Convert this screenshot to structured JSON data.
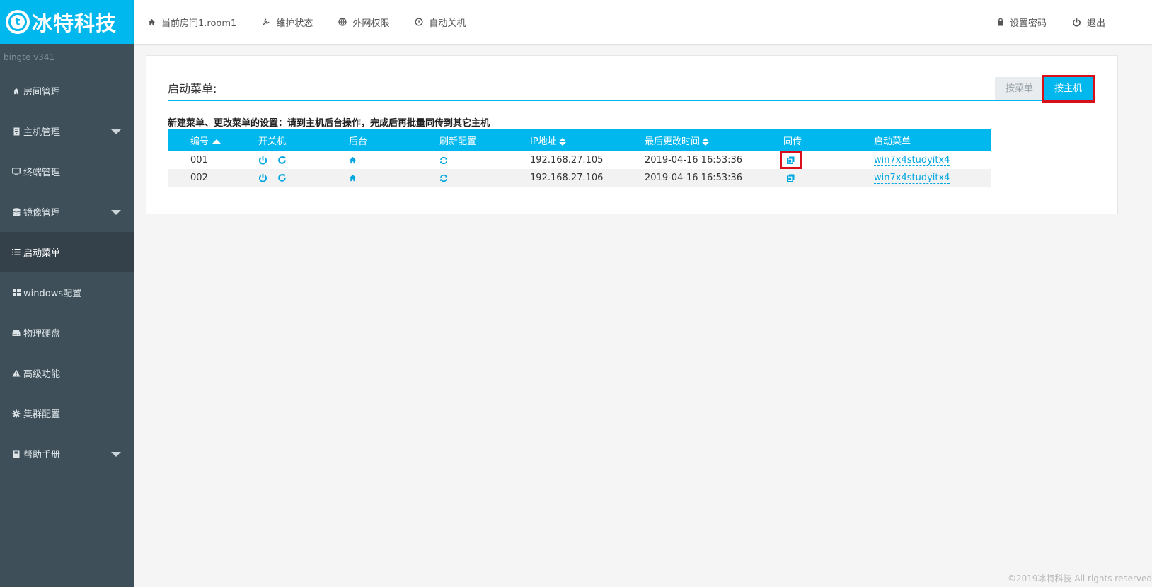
{
  "brand": {
    "logo_letter": "t",
    "name": "冰特科技"
  },
  "version": "bingte  v341",
  "topnav": {
    "left": [
      {
        "icon": "home-icon",
        "label": "当前房间1.room1"
      },
      {
        "icon": "wrench-icon",
        "label": "维护状态"
      },
      {
        "icon": "globe-icon",
        "label": "外网权限"
      },
      {
        "icon": "clock-icon",
        "label": "自动关机"
      }
    ],
    "right": [
      {
        "icon": "lock-icon",
        "label": "设置密码"
      },
      {
        "icon": "power-icon",
        "label": "退出"
      }
    ]
  },
  "sidebar": {
    "items": [
      {
        "icon": "home-icon",
        "label": "房间管理",
        "expandable": false,
        "active": false
      },
      {
        "icon": "server-icon",
        "label": "主机管理",
        "expandable": true,
        "active": false
      },
      {
        "icon": "monitor-icon",
        "label": "终端管理",
        "expandable": false,
        "active": false
      },
      {
        "icon": "database-icon",
        "label": "镜像管理",
        "expandable": true,
        "active": false
      },
      {
        "icon": "list-icon",
        "label": "启动菜单",
        "expandable": false,
        "active": true
      },
      {
        "icon": "windows-icon",
        "label": "windows配置",
        "expandable": false,
        "active": false
      },
      {
        "icon": "harddisk-icon",
        "label": "物理硬盘",
        "expandable": false,
        "active": false
      },
      {
        "icon": "warning-icon",
        "label": "高级功能",
        "expandable": false,
        "active": false
      },
      {
        "icon": "gear-icon",
        "label": "集群配置",
        "expandable": false,
        "active": false
      },
      {
        "icon": "book-icon",
        "label": "帮助手册",
        "expandable": true,
        "active": false
      }
    ]
  },
  "main": {
    "title": "启动菜单:",
    "toggle": {
      "by_menu": "按菜单",
      "by_host": "按主机",
      "selected": "by_host"
    },
    "notice": "新建菜单、更改菜单的设置：请到主机后台操作，完成后再批量同传到其它主机",
    "table": {
      "headers": [
        "编号",
        "开关机",
        "后台",
        "刷新配置",
        "IP地址",
        "最后更改时间",
        "同传",
        "启动菜单"
      ],
      "rows": [
        {
          "id": "001",
          "ip": "192.168.27.105",
          "time": "2019-04-16 16:53:36",
          "menu": "win7x4studyitx4"
        },
        {
          "id": "002",
          "ip": "192.168.27.106",
          "time": "2019-04-16 16:53:36",
          "menu": "win7x4studyitx4"
        }
      ]
    }
  },
  "footer": "©2019冰特科技 All rights reserved",
  "colors": {
    "accent": "#00b7ee",
    "sidebar": "#3f4f59",
    "sidebar_active": "#34414a",
    "highlight": "#d9101a"
  }
}
